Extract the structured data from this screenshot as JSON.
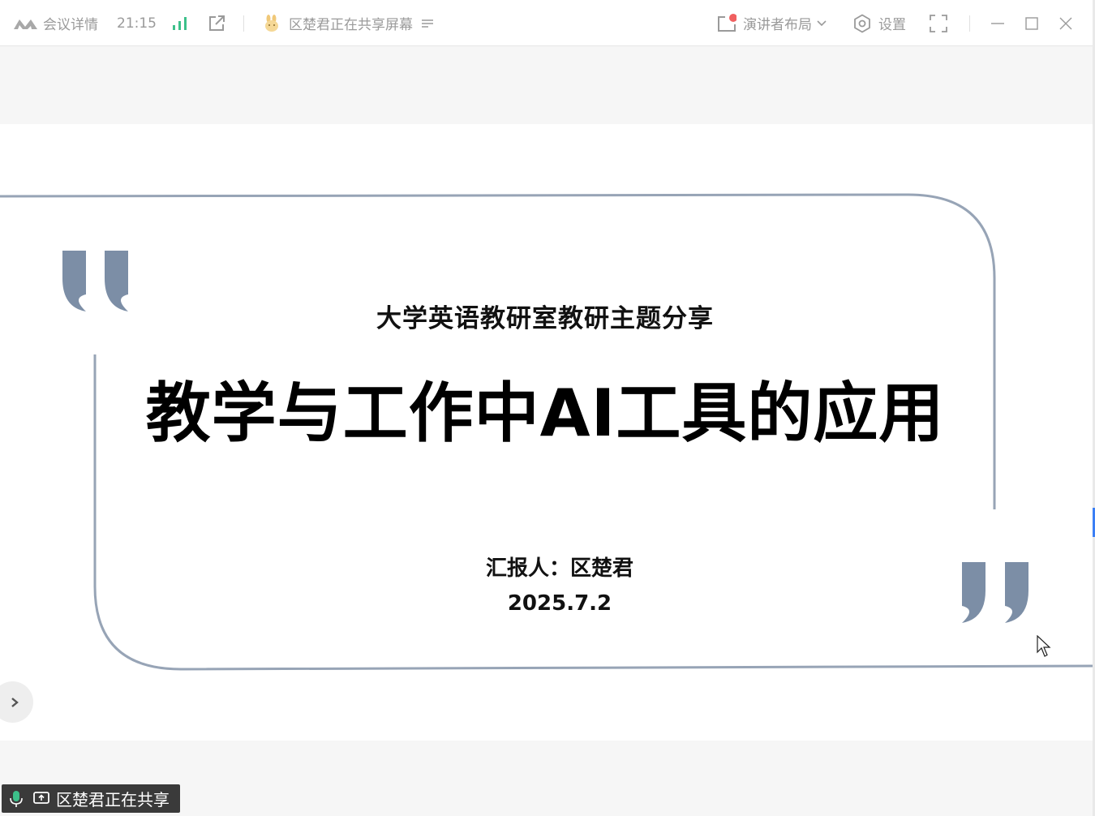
{
  "titlebar": {
    "meeting_details": "会议详情",
    "elapsed_time": "21:15",
    "sharing_status": "区楚君正在共享屏幕",
    "layout_label": "演讲者布局",
    "settings_label": "设置",
    "icons": {
      "logo": "tencent-meeting-logo",
      "signal": "signal-bars-icon",
      "popout": "external-link-icon",
      "sharer_avatar": "rabbit-avatar-icon",
      "menu": "menu-lines-icon",
      "layout": "layout-icon",
      "settings": "gear-icon",
      "fullscreen": "fullscreen-icon",
      "minimize": "minimize-icon",
      "maximize": "maximize-icon",
      "close": "close-icon"
    },
    "colors": {
      "signal_green": "#3cc08a",
      "notification_dot": "#f06060"
    }
  },
  "slide": {
    "subtitle": "大学英语教研室教研主题分享",
    "title": "教学与工作中AI工具的应用",
    "reporter": "汇报人：区楚君",
    "date": "2025.7.2",
    "accent_color": "#7c8ea6"
  },
  "share_badge": {
    "label": "区楚君正在共享"
  }
}
